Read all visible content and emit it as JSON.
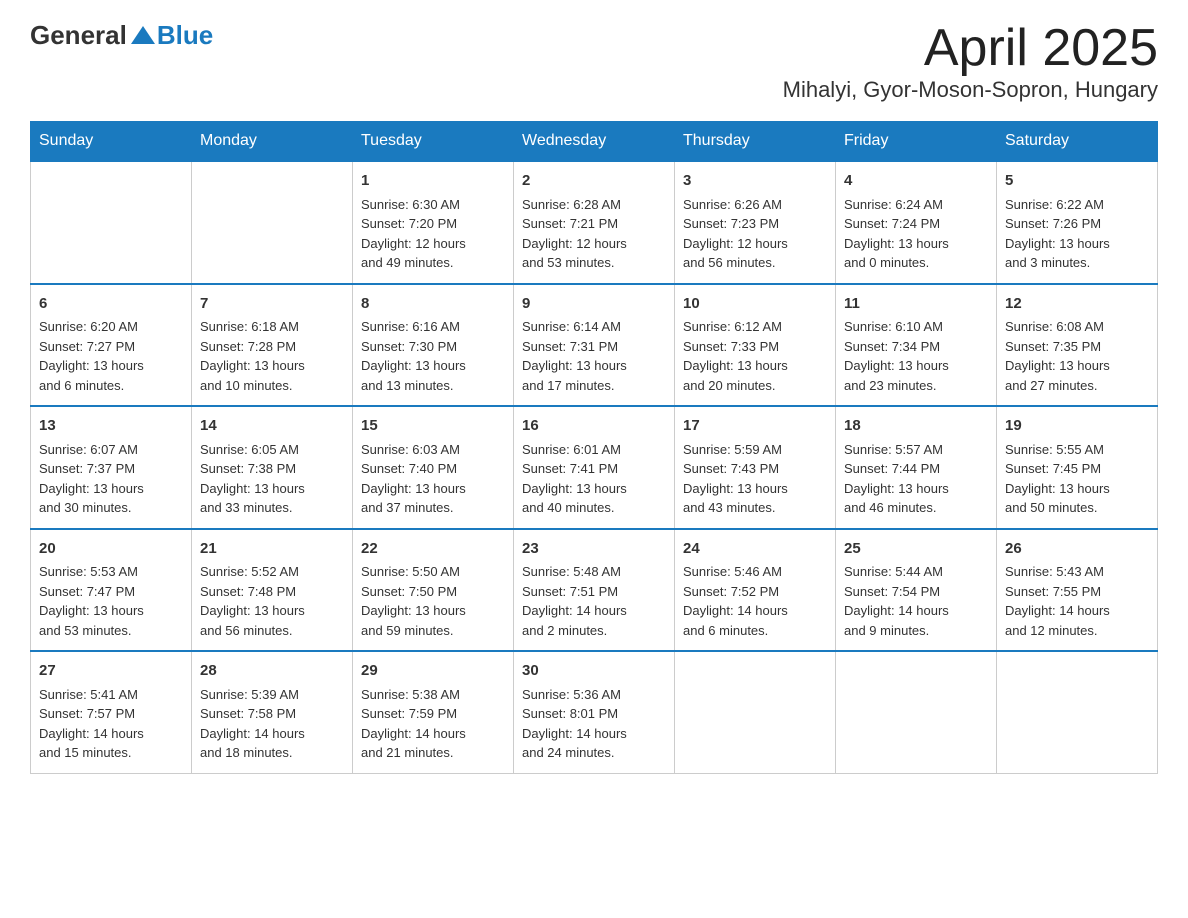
{
  "header": {
    "logo_general": "General",
    "logo_blue": "Blue",
    "title": "April 2025",
    "subtitle": "Mihalyi, Gyor-Moson-Sopron, Hungary"
  },
  "days_of_week": [
    "Sunday",
    "Monday",
    "Tuesday",
    "Wednesday",
    "Thursday",
    "Friday",
    "Saturday"
  ],
  "weeks": [
    [
      {
        "day": "",
        "info": ""
      },
      {
        "day": "",
        "info": ""
      },
      {
        "day": "1",
        "info": "Sunrise: 6:30 AM\nSunset: 7:20 PM\nDaylight: 12 hours\nand 49 minutes."
      },
      {
        "day": "2",
        "info": "Sunrise: 6:28 AM\nSunset: 7:21 PM\nDaylight: 12 hours\nand 53 minutes."
      },
      {
        "day": "3",
        "info": "Sunrise: 6:26 AM\nSunset: 7:23 PM\nDaylight: 12 hours\nand 56 minutes."
      },
      {
        "day": "4",
        "info": "Sunrise: 6:24 AM\nSunset: 7:24 PM\nDaylight: 13 hours\nand 0 minutes."
      },
      {
        "day": "5",
        "info": "Sunrise: 6:22 AM\nSunset: 7:26 PM\nDaylight: 13 hours\nand 3 minutes."
      }
    ],
    [
      {
        "day": "6",
        "info": "Sunrise: 6:20 AM\nSunset: 7:27 PM\nDaylight: 13 hours\nand 6 minutes."
      },
      {
        "day": "7",
        "info": "Sunrise: 6:18 AM\nSunset: 7:28 PM\nDaylight: 13 hours\nand 10 minutes."
      },
      {
        "day": "8",
        "info": "Sunrise: 6:16 AM\nSunset: 7:30 PM\nDaylight: 13 hours\nand 13 minutes."
      },
      {
        "day": "9",
        "info": "Sunrise: 6:14 AM\nSunset: 7:31 PM\nDaylight: 13 hours\nand 17 minutes."
      },
      {
        "day": "10",
        "info": "Sunrise: 6:12 AM\nSunset: 7:33 PM\nDaylight: 13 hours\nand 20 minutes."
      },
      {
        "day": "11",
        "info": "Sunrise: 6:10 AM\nSunset: 7:34 PM\nDaylight: 13 hours\nand 23 minutes."
      },
      {
        "day": "12",
        "info": "Sunrise: 6:08 AM\nSunset: 7:35 PM\nDaylight: 13 hours\nand 27 minutes."
      }
    ],
    [
      {
        "day": "13",
        "info": "Sunrise: 6:07 AM\nSunset: 7:37 PM\nDaylight: 13 hours\nand 30 minutes."
      },
      {
        "day": "14",
        "info": "Sunrise: 6:05 AM\nSunset: 7:38 PM\nDaylight: 13 hours\nand 33 minutes."
      },
      {
        "day": "15",
        "info": "Sunrise: 6:03 AM\nSunset: 7:40 PM\nDaylight: 13 hours\nand 37 minutes."
      },
      {
        "day": "16",
        "info": "Sunrise: 6:01 AM\nSunset: 7:41 PM\nDaylight: 13 hours\nand 40 minutes."
      },
      {
        "day": "17",
        "info": "Sunrise: 5:59 AM\nSunset: 7:43 PM\nDaylight: 13 hours\nand 43 minutes."
      },
      {
        "day": "18",
        "info": "Sunrise: 5:57 AM\nSunset: 7:44 PM\nDaylight: 13 hours\nand 46 minutes."
      },
      {
        "day": "19",
        "info": "Sunrise: 5:55 AM\nSunset: 7:45 PM\nDaylight: 13 hours\nand 50 minutes."
      }
    ],
    [
      {
        "day": "20",
        "info": "Sunrise: 5:53 AM\nSunset: 7:47 PM\nDaylight: 13 hours\nand 53 minutes."
      },
      {
        "day": "21",
        "info": "Sunrise: 5:52 AM\nSunset: 7:48 PM\nDaylight: 13 hours\nand 56 minutes."
      },
      {
        "day": "22",
        "info": "Sunrise: 5:50 AM\nSunset: 7:50 PM\nDaylight: 13 hours\nand 59 minutes."
      },
      {
        "day": "23",
        "info": "Sunrise: 5:48 AM\nSunset: 7:51 PM\nDaylight: 14 hours\nand 2 minutes."
      },
      {
        "day": "24",
        "info": "Sunrise: 5:46 AM\nSunset: 7:52 PM\nDaylight: 14 hours\nand 6 minutes."
      },
      {
        "day": "25",
        "info": "Sunrise: 5:44 AM\nSunset: 7:54 PM\nDaylight: 14 hours\nand 9 minutes."
      },
      {
        "day": "26",
        "info": "Sunrise: 5:43 AM\nSunset: 7:55 PM\nDaylight: 14 hours\nand 12 minutes."
      }
    ],
    [
      {
        "day": "27",
        "info": "Sunrise: 5:41 AM\nSunset: 7:57 PM\nDaylight: 14 hours\nand 15 minutes."
      },
      {
        "day": "28",
        "info": "Sunrise: 5:39 AM\nSunset: 7:58 PM\nDaylight: 14 hours\nand 18 minutes."
      },
      {
        "day": "29",
        "info": "Sunrise: 5:38 AM\nSunset: 7:59 PM\nDaylight: 14 hours\nand 21 minutes."
      },
      {
        "day": "30",
        "info": "Sunrise: 5:36 AM\nSunset: 8:01 PM\nDaylight: 14 hours\nand 24 minutes."
      },
      {
        "day": "",
        "info": ""
      },
      {
        "day": "",
        "info": ""
      },
      {
        "day": "",
        "info": ""
      }
    ]
  ]
}
